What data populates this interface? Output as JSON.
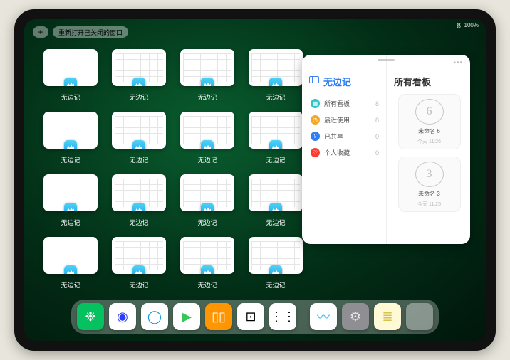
{
  "status": {
    "wifi": "᯾",
    "battery": "100%"
  },
  "topbar": {
    "plus_label": "+",
    "reopen_label": "重新打开已关闭的窗口"
  },
  "thumbs": {
    "label": "无边记",
    "items": [
      {
        "variant": "blank"
      },
      {
        "variant": "cal"
      },
      {
        "variant": "cal"
      },
      {
        "variant": "cal"
      },
      {
        "variant": "blank"
      },
      {
        "variant": "cal"
      },
      {
        "variant": "cal"
      },
      {
        "variant": "cal"
      },
      {
        "variant": "blank"
      },
      {
        "variant": "cal"
      },
      {
        "variant": "cal"
      },
      {
        "variant": "cal"
      },
      {
        "variant": "blank"
      },
      {
        "variant": "cal"
      },
      {
        "variant": "cal"
      },
      {
        "variant": "cal"
      }
    ]
  },
  "panel": {
    "title_left": "无边记",
    "title_right": "所有看板",
    "categories": [
      {
        "icon": "▦",
        "color": "#2ec4c5",
        "label": "所有看板",
        "count": "8"
      },
      {
        "icon": "◷",
        "color": "#f5a623",
        "label": "最近使用",
        "count": "8"
      },
      {
        "icon": "⇪",
        "color": "#2f7df4",
        "label": "已共享",
        "count": "0"
      },
      {
        "icon": "♡",
        "color": "#ff3b30",
        "label": "个人收藏",
        "count": "0"
      }
    ],
    "boards": [
      {
        "glyph": "6",
        "name": "未命名 6",
        "time": "今天 11:26"
      },
      {
        "glyph": "3",
        "name": "未命名 3",
        "time": "今天 11:25"
      }
    ]
  },
  "dock": {
    "apps": [
      {
        "name": "wechat",
        "bg": "#05c160",
        "glyph": "❉",
        "fg": "#fff"
      },
      {
        "name": "quark",
        "bg": "#ffffff",
        "glyph": "◉",
        "fg": "#2c3cff"
      },
      {
        "name": "qqbrowser",
        "bg": "#ffffff",
        "glyph": "◯",
        "fg": "#1296db"
      },
      {
        "name": "play",
        "bg": "#ffffff",
        "glyph": "▶",
        "fg": "#34c759"
      },
      {
        "name": "books",
        "bg": "#ff9500",
        "glyph": "▯▯",
        "fg": "#fff"
      },
      {
        "name": "dice",
        "bg": "#ffffff",
        "glyph": "⊡",
        "fg": "#000"
      },
      {
        "name": "nodes",
        "bg": "#ffffff",
        "glyph": "⋮⋮",
        "fg": "#000"
      }
    ],
    "recent": [
      {
        "name": "freeform",
        "bg": "#ffffff",
        "glyph": "〰",
        "fg": "#2fb6ff"
      },
      {
        "name": "settings",
        "bg": "#8e8e93",
        "glyph": "⚙",
        "fg": "#e8e8e8"
      },
      {
        "name": "notes",
        "bg": "#fff9d6",
        "glyph": "≣",
        "fg": "#d9c04a"
      }
    ]
  }
}
